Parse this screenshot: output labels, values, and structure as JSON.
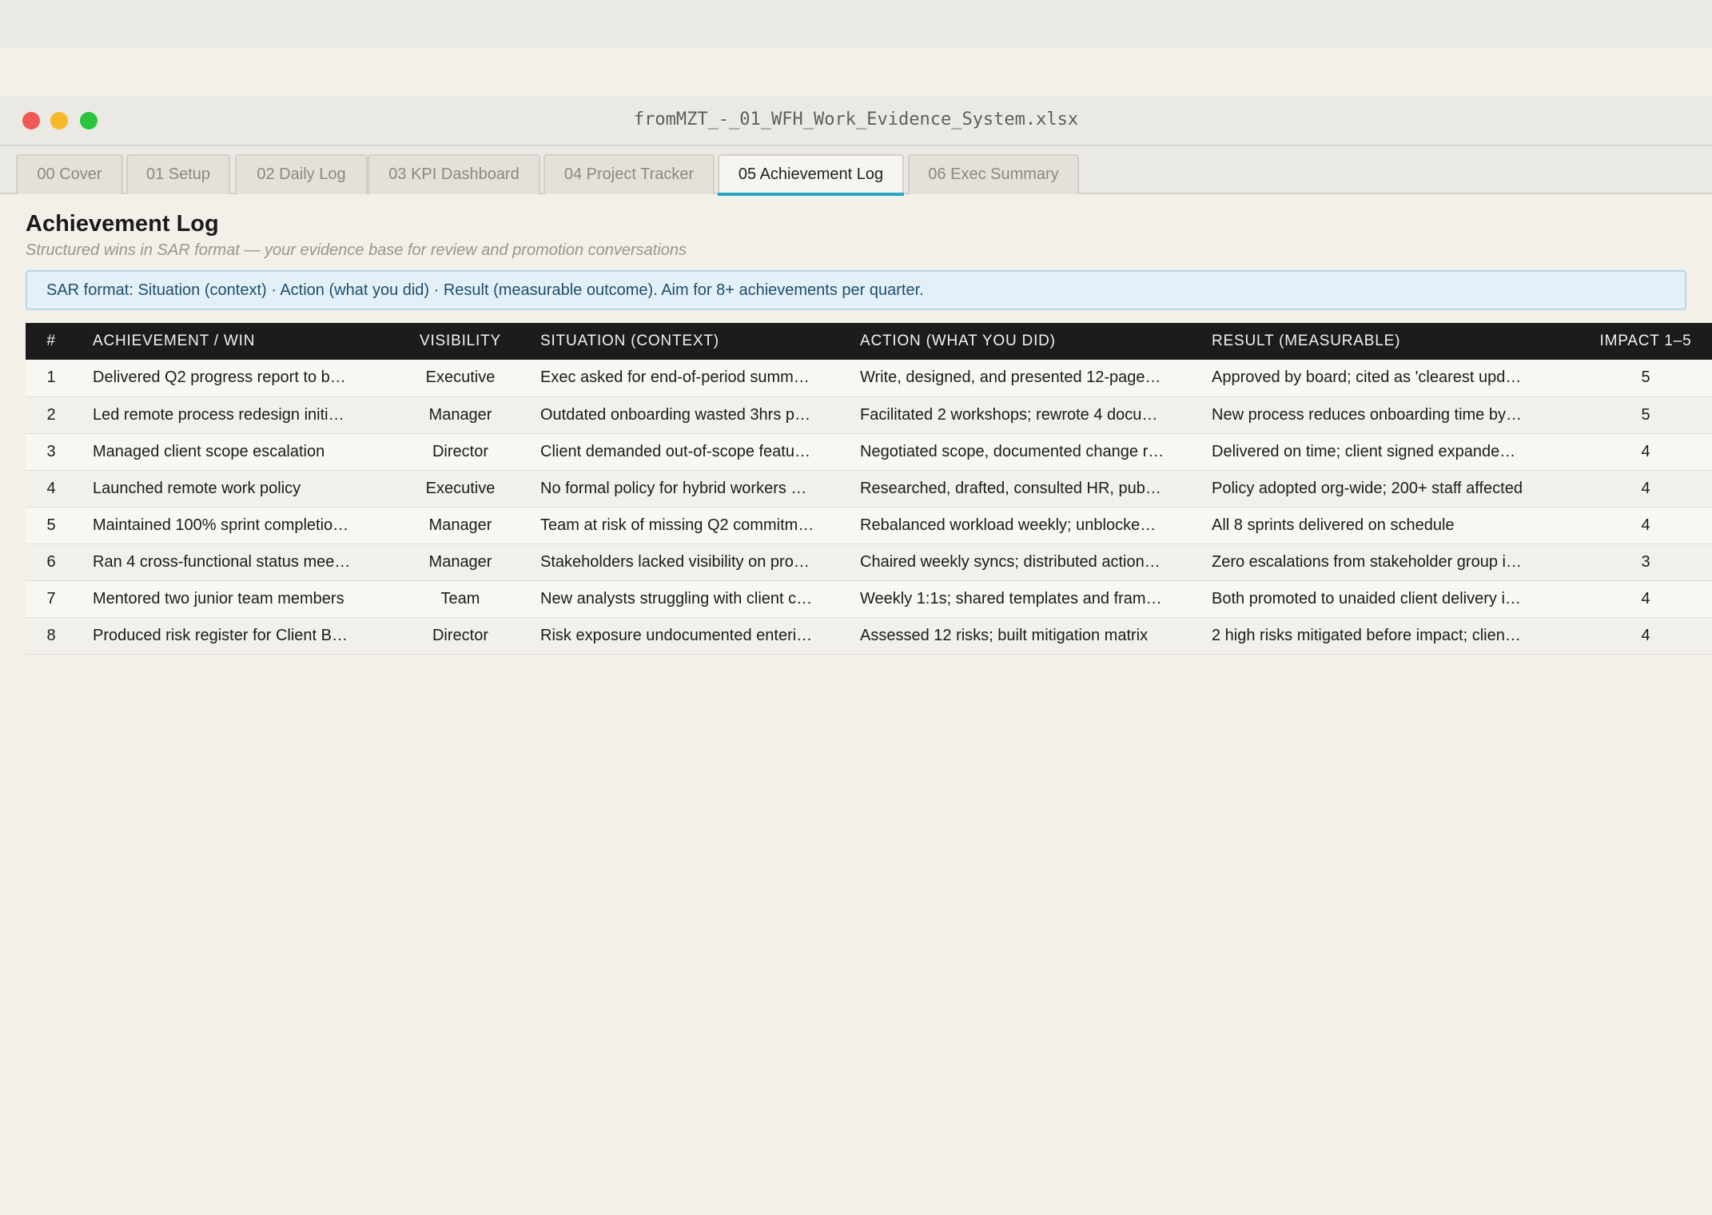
{
  "window": {
    "title": "fromMZT_-_01_WFH_Work_Evidence_System.xlsx"
  },
  "tabs": [
    {
      "label": "00 Cover",
      "active": false
    },
    {
      "label": "01 Setup",
      "active": false
    },
    {
      "label": "02 Daily Log",
      "active": false
    },
    {
      "label": "03 KPI Dashboard",
      "active": false
    },
    {
      "label": "04 Project Tracker",
      "active": false
    },
    {
      "label": "05 Achievement Log",
      "active": true
    },
    {
      "label": "06 Exec Summary",
      "active": false
    }
  ],
  "sheet": {
    "title": "Achievement Log",
    "subtitle": "Structured wins in SAR format — your evidence base for review and promotion conversations",
    "banner": "SAR format: Situation (context) · Action (what you did) · Result (measurable outcome). Aim for 8+ achievements per quarter."
  },
  "table": {
    "headers": [
      "#",
      "ACHIEVEMENT / WIN",
      "VISIBILITY",
      "SITUATION (CONTEXT)",
      "ACTION (WHAT YOU DID)",
      "RESULT (MEASURABLE)",
      "IMPACT 1–5"
    ],
    "rows": [
      [
        "1",
        "Delivered Q2 progress report to b…",
        "Executive",
        "Exec asked for end-of-period summ…",
        "Write, designed, and presented 12-page…",
        "Approved by board; cited as 'clearest upd…",
        "5"
      ],
      [
        "2",
        "Led remote process redesign initi…",
        "Manager",
        "Outdated onboarding wasted 3hrs p…",
        "Facilitated 2 workshops; rewrote 4 docu…",
        "New process reduces onboarding time by…",
        "5"
      ],
      [
        "3",
        "Managed client scope escalation",
        "Director",
        "Client demanded out-of-scope featu…",
        "Negotiated scope, documented change r…",
        "Delivered on time; client signed expande…",
        "4"
      ],
      [
        "4",
        "Launched remote work policy",
        "Executive",
        "No formal policy for hybrid workers …",
        "Researched, drafted, consulted HR, pub…",
        "Policy adopted org-wide; 200+ staff affected",
        "4"
      ],
      [
        "5",
        "Maintained 100% sprint completio…",
        "Manager",
        "Team at risk of missing Q2 commitm…",
        "Rebalanced workload weekly; unblocke…",
        "All 8 sprints delivered on schedule",
        "4"
      ],
      [
        "6",
        "Ran 4 cross-functional status mee…",
        "Manager",
        "Stakeholders lacked visibility on pro…",
        "Chaired weekly syncs; distributed action…",
        "Zero escalations from stakeholder group i…",
        "3"
      ],
      [
        "7",
        "Mentored two junior team members",
        "Team",
        "New analysts struggling with client c…",
        "Weekly 1:1s; shared templates and fram…",
        "Both promoted to unaided client delivery i…",
        "4"
      ],
      [
        "8",
        "Produced risk register for Client B…",
        "Director",
        "Risk exposure undocumented enteri…",
        "Assessed 12 risks; built mitigation matrix",
        "2 high risks mitigated before impact; clien…",
        "4"
      ]
    ]
  }
}
